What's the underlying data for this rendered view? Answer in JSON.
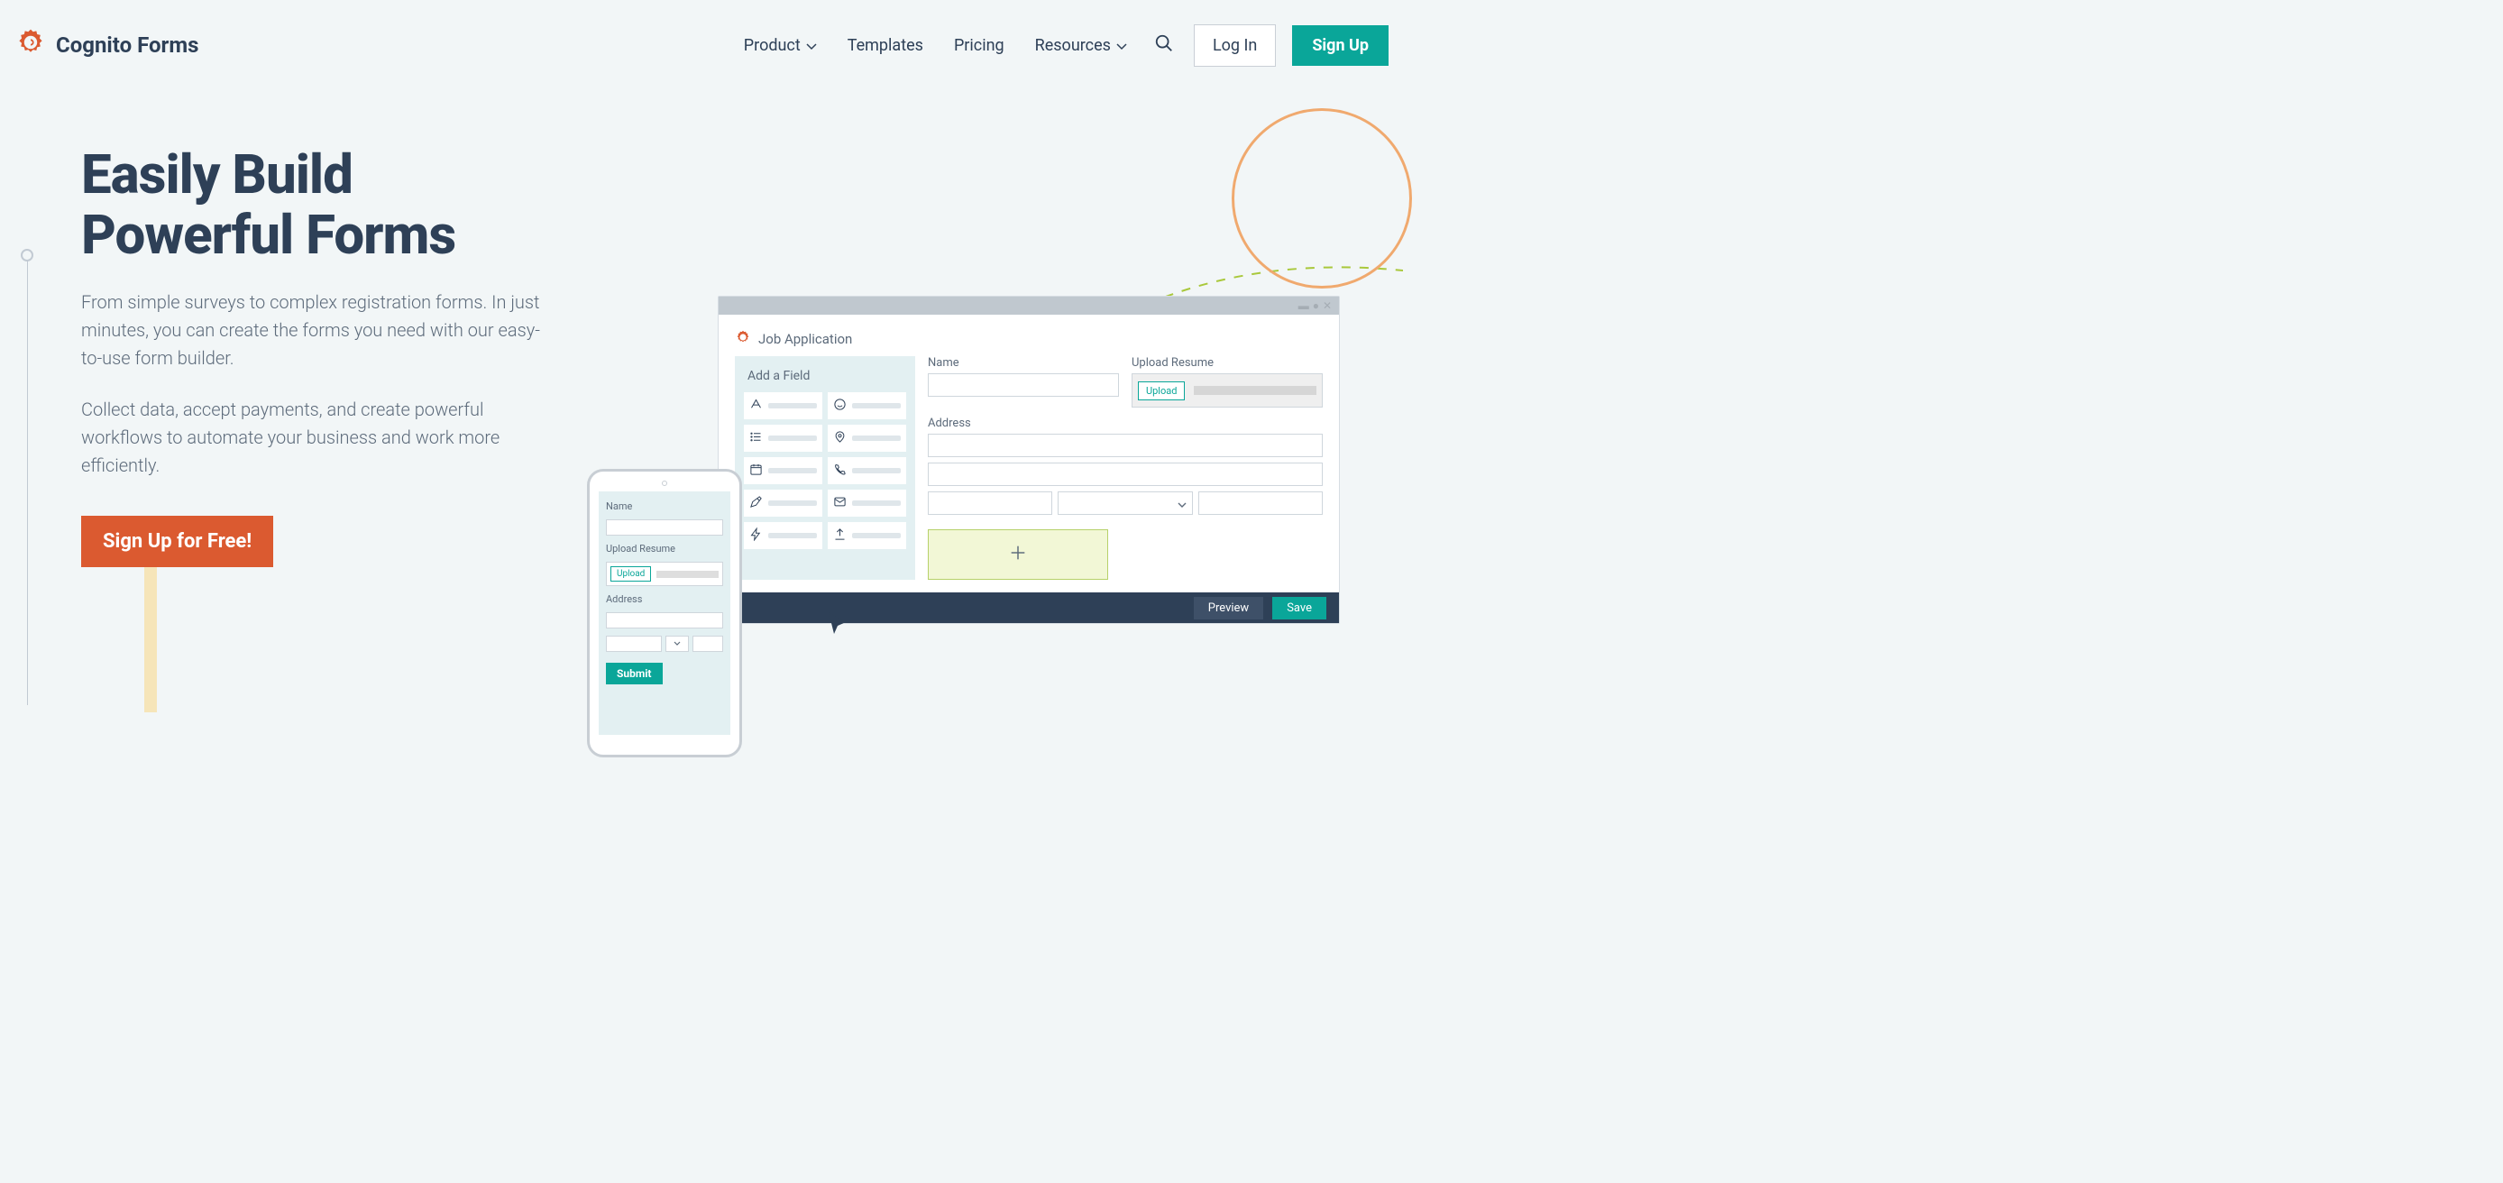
{
  "brand": {
    "name": "Cognito Forms"
  },
  "nav": {
    "product": "Product",
    "templates": "Templates",
    "pricing": "Pricing",
    "resources": "Resources",
    "login": "Log In",
    "signup": "Sign Up"
  },
  "hero": {
    "title_line1": "Easily Build",
    "title_line2": "Powerful Forms",
    "desc1": "From simple surveys to complex registration forms. In just minutes, you can create the forms you need with our easy-to-use form builder.",
    "desc2": "Collect data, accept payments, and create powerful workflows to automate your business and work more efficiently.",
    "cta": "Sign Up for Free!"
  },
  "builder": {
    "form_title": "Job Application",
    "palette_title": "Add a Field",
    "name_label": "Name",
    "upload_label": "Upload Resume",
    "upload_btn": "Upload",
    "address_label": "Address",
    "preview_btn": "Preview",
    "save_btn": "Save"
  },
  "phone": {
    "name_label": "Name",
    "upload_label": "Upload Resume",
    "upload_btn": "Upload",
    "address_label": "Address",
    "submit": "Submit"
  }
}
